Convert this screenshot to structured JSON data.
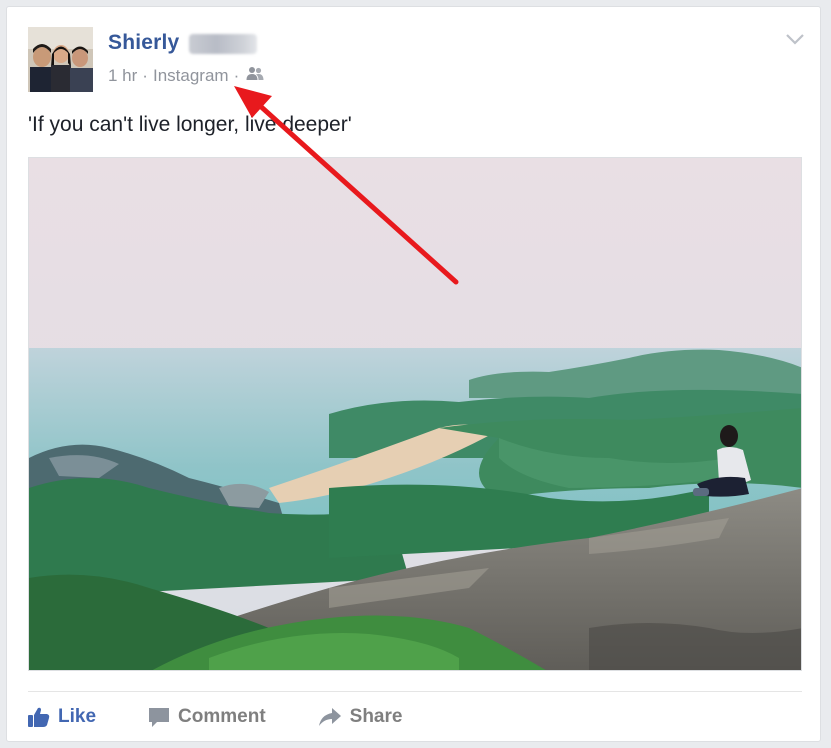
{
  "post": {
    "author": "Shierly",
    "time": "1 hr",
    "via": "Instagram",
    "separator": "·",
    "audience_icon": "friends-icon",
    "options_icon": "chevron-down-icon",
    "text": "'If you can't live longer, live deeper'"
  },
  "actions": {
    "like_label": "Like",
    "comment_label": "Comment",
    "share_label": "Share"
  },
  "colors": {
    "author": "#365899",
    "meta": "#90949c",
    "like": "#4267b2",
    "action": "#7f7f7f",
    "annotation_arrow": "#e8191d"
  }
}
